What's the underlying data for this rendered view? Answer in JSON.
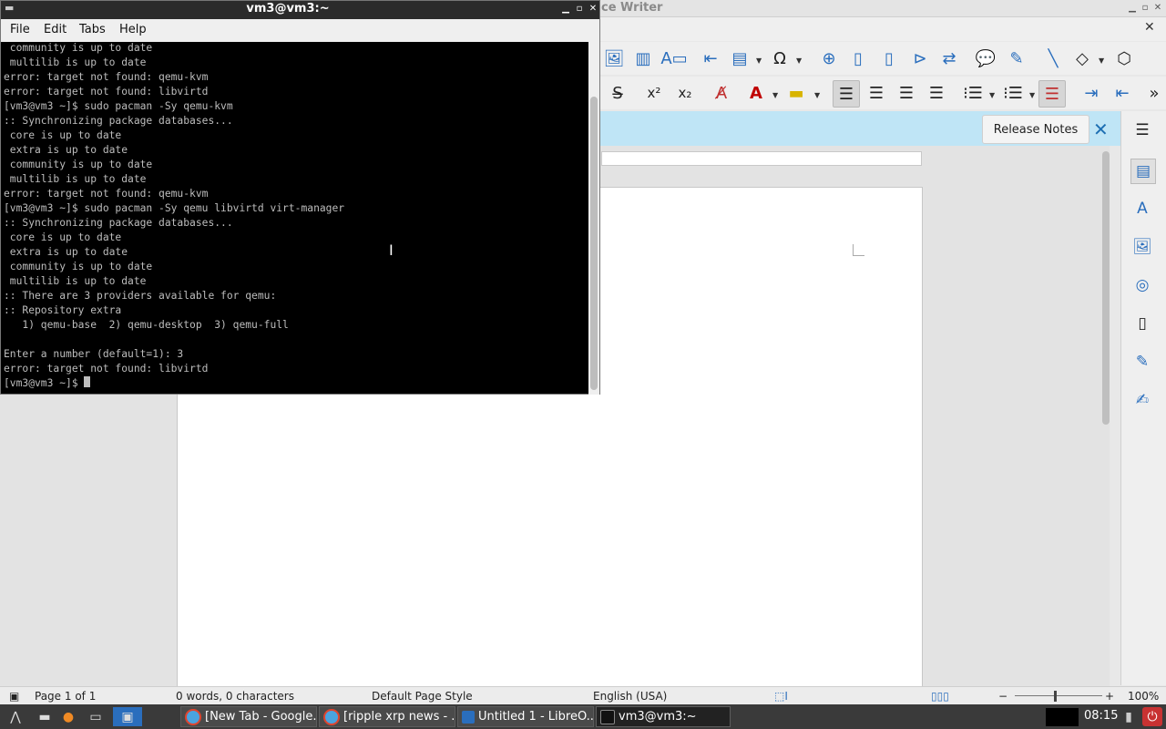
{
  "writer": {
    "title": "ce Writer",
    "release_notes": "Release Notes",
    "infobar_close": "✕",
    "close_doc": "✕",
    "sidebar_menu": "☰",
    "status": {
      "page": "Page 1 of 1",
      "words": "0 words, 0 characters",
      "page_style": "Default Page Style",
      "language": "English (USA)",
      "zoom": "100%"
    }
  },
  "terminal": {
    "title": "vm3@vm3:~",
    "menu": [
      "File",
      "Edit",
      "Tabs",
      "Help"
    ],
    "lines": [
      " community is up to date",
      " multilib is up to date",
      "error: target not found: qemu-kvm",
      "error: target not found: libvirtd",
      "[vm3@vm3 ~]$ sudo pacman -Sy qemu-kvm",
      ":: Synchronizing package databases...",
      " core is up to date",
      " extra is up to date",
      " community is up to date",
      " multilib is up to date",
      "error: target not found: qemu-kvm",
      "[vm3@vm3 ~]$ sudo pacman -Sy qemu libvirtd virt-manager",
      ":: Synchronizing package databases...",
      " core is up to date",
      " extra is up to date",
      " community is up to date",
      " multilib is up to date",
      ":: There are 3 providers available for qemu:",
      ":: Repository extra",
      "   1) qemu-base  2) qemu-desktop  3) qemu-full",
      "",
      "Enter a number (default=1): 3",
      "error: target not found: libvirtd"
    ],
    "prompt": "[vm3@vm3 ~]$ "
  },
  "taskbar": {
    "tasks": [
      {
        "label": "[New Tab - Google..."
      },
      {
        "label": "[ripple xrp news - ..."
      },
      {
        "label": "Untitled 1 - LibreO..."
      },
      {
        "label": "vm3@vm3:~"
      }
    ],
    "clock": "08:15"
  },
  "colors": {
    "infobar": "#bfe5f6",
    "terminal_bg": "#000000",
    "accent": "#2a6ebd"
  }
}
